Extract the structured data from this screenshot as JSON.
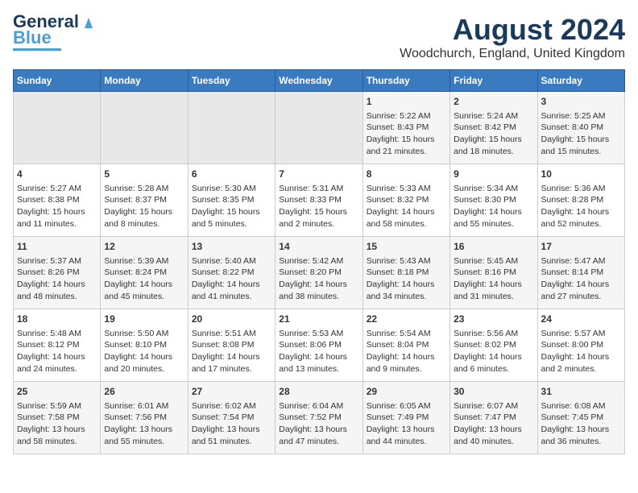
{
  "header": {
    "logo_line1": "General",
    "logo_line2": "Blue",
    "month": "August 2024",
    "location": "Woodchurch, England, United Kingdom"
  },
  "days_of_week": [
    "Sunday",
    "Monday",
    "Tuesday",
    "Wednesday",
    "Thursday",
    "Friday",
    "Saturday"
  ],
  "weeks": [
    [
      {
        "day": "",
        "content": ""
      },
      {
        "day": "",
        "content": ""
      },
      {
        "day": "",
        "content": ""
      },
      {
        "day": "",
        "content": ""
      },
      {
        "day": "1",
        "content": "Sunrise: 5:22 AM\nSunset: 8:43 PM\nDaylight: 15 hours\nand 21 minutes."
      },
      {
        "day": "2",
        "content": "Sunrise: 5:24 AM\nSunset: 8:42 PM\nDaylight: 15 hours\nand 18 minutes."
      },
      {
        "day": "3",
        "content": "Sunrise: 5:25 AM\nSunset: 8:40 PM\nDaylight: 15 hours\nand 15 minutes."
      }
    ],
    [
      {
        "day": "4",
        "content": "Sunrise: 5:27 AM\nSunset: 8:38 PM\nDaylight: 15 hours\nand 11 minutes."
      },
      {
        "day": "5",
        "content": "Sunrise: 5:28 AM\nSunset: 8:37 PM\nDaylight: 15 hours\nand 8 minutes."
      },
      {
        "day": "6",
        "content": "Sunrise: 5:30 AM\nSunset: 8:35 PM\nDaylight: 15 hours\nand 5 minutes."
      },
      {
        "day": "7",
        "content": "Sunrise: 5:31 AM\nSunset: 8:33 PM\nDaylight: 15 hours\nand 2 minutes."
      },
      {
        "day": "8",
        "content": "Sunrise: 5:33 AM\nSunset: 8:32 PM\nDaylight: 14 hours\nand 58 minutes."
      },
      {
        "day": "9",
        "content": "Sunrise: 5:34 AM\nSunset: 8:30 PM\nDaylight: 14 hours\nand 55 minutes."
      },
      {
        "day": "10",
        "content": "Sunrise: 5:36 AM\nSunset: 8:28 PM\nDaylight: 14 hours\nand 52 minutes."
      }
    ],
    [
      {
        "day": "11",
        "content": "Sunrise: 5:37 AM\nSunset: 8:26 PM\nDaylight: 14 hours\nand 48 minutes."
      },
      {
        "day": "12",
        "content": "Sunrise: 5:39 AM\nSunset: 8:24 PM\nDaylight: 14 hours\nand 45 minutes."
      },
      {
        "day": "13",
        "content": "Sunrise: 5:40 AM\nSunset: 8:22 PM\nDaylight: 14 hours\nand 41 minutes."
      },
      {
        "day": "14",
        "content": "Sunrise: 5:42 AM\nSunset: 8:20 PM\nDaylight: 14 hours\nand 38 minutes."
      },
      {
        "day": "15",
        "content": "Sunrise: 5:43 AM\nSunset: 8:18 PM\nDaylight: 14 hours\nand 34 minutes."
      },
      {
        "day": "16",
        "content": "Sunrise: 5:45 AM\nSunset: 8:16 PM\nDaylight: 14 hours\nand 31 minutes."
      },
      {
        "day": "17",
        "content": "Sunrise: 5:47 AM\nSunset: 8:14 PM\nDaylight: 14 hours\nand 27 minutes."
      }
    ],
    [
      {
        "day": "18",
        "content": "Sunrise: 5:48 AM\nSunset: 8:12 PM\nDaylight: 14 hours\nand 24 minutes."
      },
      {
        "day": "19",
        "content": "Sunrise: 5:50 AM\nSunset: 8:10 PM\nDaylight: 14 hours\nand 20 minutes."
      },
      {
        "day": "20",
        "content": "Sunrise: 5:51 AM\nSunset: 8:08 PM\nDaylight: 14 hours\nand 17 minutes."
      },
      {
        "day": "21",
        "content": "Sunrise: 5:53 AM\nSunset: 8:06 PM\nDaylight: 14 hours\nand 13 minutes."
      },
      {
        "day": "22",
        "content": "Sunrise: 5:54 AM\nSunset: 8:04 PM\nDaylight: 14 hours\nand 9 minutes."
      },
      {
        "day": "23",
        "content": "Sunrise: 5:56 AM\nSunset: 8:02 PM\nDaylight: 14 hours\nand 6 minutes."
      },
      {
        "day": "24",
        "content": "Sunrise: 5:57 AM\nSunset: 8:00 PM\nDaylight: 14 hours\nand 2 minutes."
      }
    ],
    [
      {
        "day": "25",
        "content": "Sunrise: 5:59 AM\nSunset: 7:58 PM\nDaylight: 13 hours\nand 58 minutes."
      },
      {
        "day": "26",
        "content": "Sunrise: 6:01 AM\nSunset: 7:56 PM\nDaylight: 13 hours\nand 55 minutes."
      },
      {
        "day": "27",
        "content": "Sunrise: 6:02 AM\nSunset: 7:54 PM\nDaylight: 13 hours\nand 51 minutes."
      },
      {
        "day": "28",
        "content": "Sunrise: 6:04 AM\nSunset: 7:52 PM\nDaylight: 13 hours\nand 47 minutes."
      },
      {
        "day": "29",
        "content": "Sunrise: 6:05 AM\nSunset: 7:49 PM\nDaylight: 13 hours\nand 44 minutes."
      },
      {
        "day": "30",
        "content": "Sunrise: 6:07 AM\nSunset: 7:47 PM\nDaylight: 13 hours\nand 40 minutes."
      },
      {
        "day": "31",
        "content": "Sunrise: 6:08 AM\nSunset: 7:45 PM\nDaylight: 13 hours\nand 36 minutes."
      }
    ]
  ]
}
